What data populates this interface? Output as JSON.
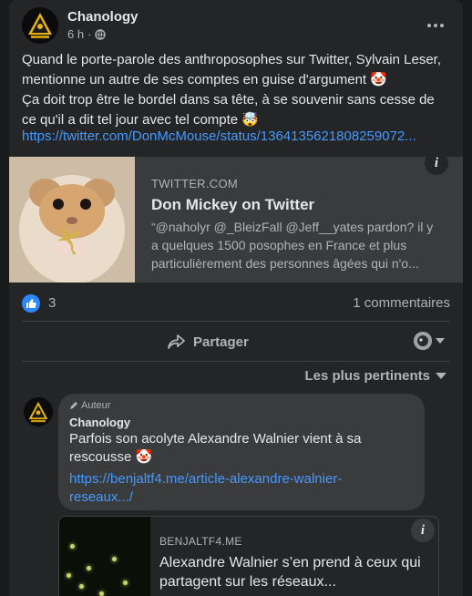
{
  "post": {
    "author": "Chanology",
    "time": "6 h",
    "separator": "·",
    "text": "Quand le porte-parole des anthroposophes sur Twitter, Sylvain Leser, mentionne un autre de ses comptes en guise d'argument 🤡\nÇa doit trop être le bordel dans sa tête, à se souvenir sans cesse de ce qu'il a dit tel jour avec tel compte 🤯",
    "link": "https://twitter.com/DonMcMouse/status/1364135621808259072...",
    "preview": {
      "domain": "TWITTER.COM",
      "title": "Don Mickey on Twitter",
      "description": "“@naholyr @_BleizFall @Jeff__yates pardon? il y a quelques 1500 posophes en France et plus particulièrement des personnes âgées qui n'o..."
    },
    "likes": "3",
    "comments_count": "1 commentaires",
    "share_label": "Partager"
  },
  "sort_label": "Les plus pertinents",
  "comment": {
    "badge": "Auteur",
    "author": "Chanology",
    "text": "Parfois son acolyte Alexandre Walnier vient à sa rescousse 🤡",
    "link": "https://benjaltf4.me/article-alexandre-walnier-reseaux.../",
    "preview": {
      "domain": "BENJALTF4.ME",
      "title": "Alexandre Walnier s’en prend à ceux qui partagent sur les réseaux..."
    }
  },
  "colors": {
    "link": "#4599ff",
    "like": "#2d88ff",
    "card": "#242526",
    "background": "#18191a"
  }
}
